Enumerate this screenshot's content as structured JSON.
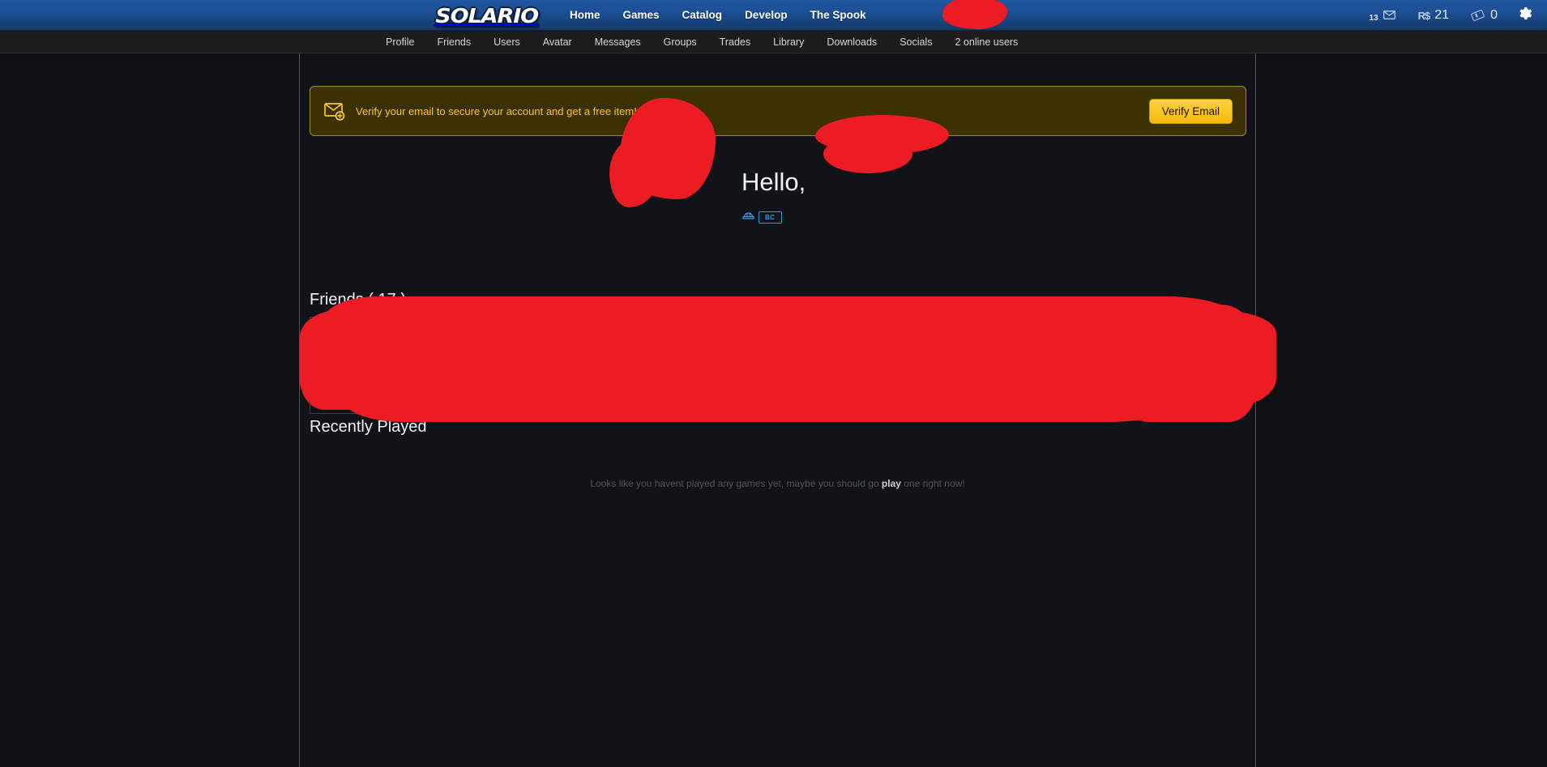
{
  "brand": {
    "name": "SOLARIO",
    "logo_icon": "solario-logo"
  },
  "topnav": {
    "items": [
      {
        "label": "Home"
      },
      {
        "label": "Games"
      },
      {
        "label": "Catalog"
      },
      {
        "label": "Develop"
      },
      {
        "label": "The Spook"
      }
    ]
  },
  "topright": {
    "messages_count": "13",
    "messages_icon": "envelope-icon",
    "currency_symbol": "R$",
    "currency_value": "21",
    "tickets_icon": "ticket-icon",
    "tickets_value": "0",
    "settings_icon": "gear-icon"
  },
  "subnav": {
    "items": [
      {
        "label": "Profile"
      },
      {
        "label": "Friends"
      },
      {
        "label": "Users"
      },
      {
        "label": "Avatar"
      },
      {
        "label": "Messages"
      },
      {
        "label": "Groups"
      },
      {
        "label": "Trades"
      },
      {
        "label": "Library"
      },
      {
        "label": "Downloads"
      },
      {
        "label": "Socials"
      },
      {
        "label": "2 online users"
      }
    ]
  },
  "verify_banner": {
    "icon": "envelope-add-icon",
    "message": "Verify your email to secure your account and get a free item!",
    "button_label": "Verify Email",
    "accent_color": "#ffc527",
    "background_color": "#3b3102"
  },
  "profile": {
    "avatar_icon": "user-avatar",
    "greeting": "Hello,",
    "username": "",
    "badge": {
      "icon": "hardhat-icon",
      "label": "BC",
      "color": "#1fa3f0"
    }
  },
  "friends": {
    "heading": "Friends ( 17 )",
    "count": "17",
    "list": []
  },
  "recently_played": {
    "heading": "Recently Played",
    "empty_prefix": "Looks like you havent played any games yet, maybe you should go ",
    "empty_link": "play",
    "empty_suffix": " one right now!"
  },
  "colors": {
    "nav_top": "#2157a0",
    "nav_bottom": "#143869",
    "page_bg": "#0d0f12",
    "container_bg": "#101317",
    "redaction": "#ec1c24"
  }
}
